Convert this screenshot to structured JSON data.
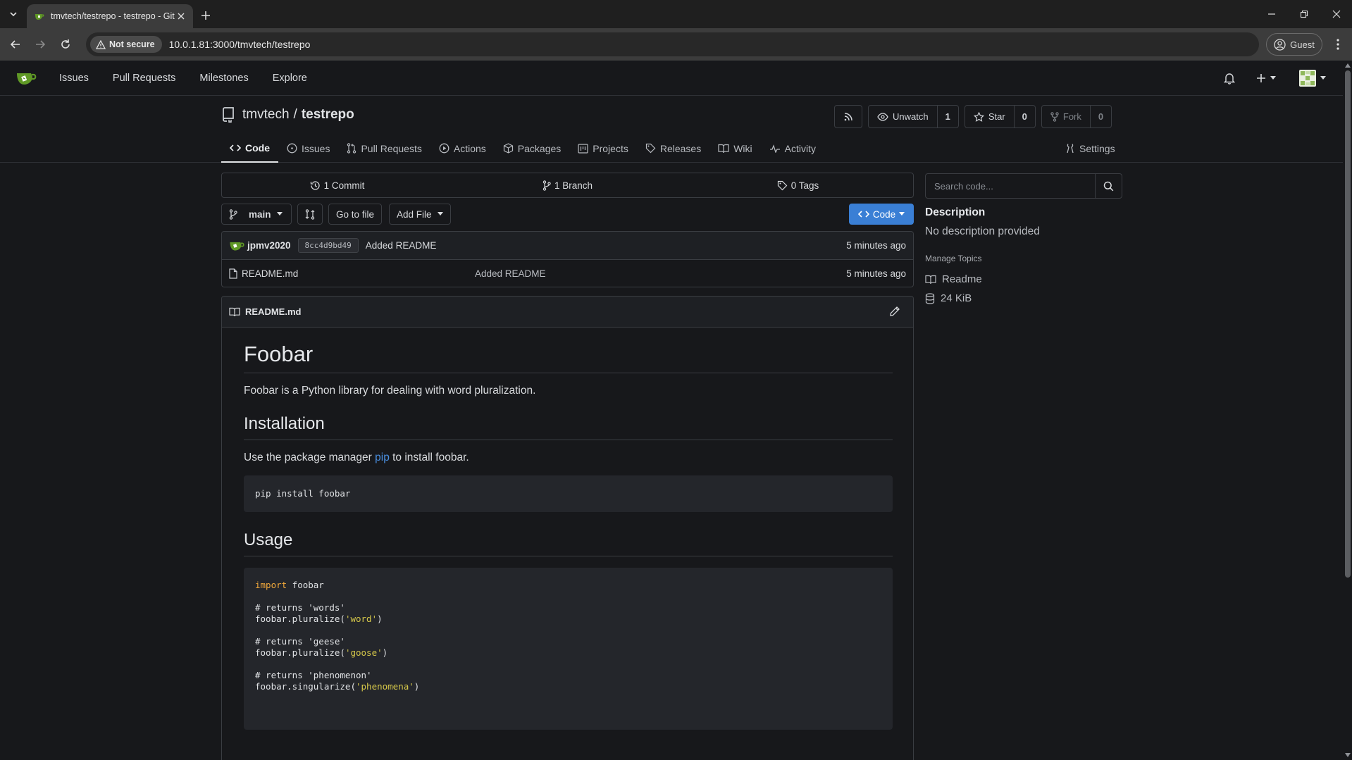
{
  "browser": {
    "tab_title": "tmvtech/testrepo - testrepo - Gitea",
    "security_label": "Not secure",
    "url": "10.0.1.81:3000/tmvtech/testrepo",
    "profile_label": "Guest"
  },
  "header": {
    "nav": [
      "Issues",
      "Pull Requests",
      "Milestones",
      "Explore"
    ]
  },
  "repo": {
    "owner": "tmvtech",
    "separator": "/",
    "name": "testrepo",
    "actions": {
      "unwatch_label": "Unwatch",
      "watch_count": "1",
      "star_label": "Star",
      "star_count": "0",
      "fork_label": "Fork",
      "fork_count": "0"
    },
    "tabs": {
      "code": "Code",
      "issues": "Issues",
      "pulls": "Pull Requests",
      "actions": "Actions",
      "packages": "Packages",
      "projects": "Projects",
      "releases": "Releases",
      "wiki": "Wiki",
      "activity": "Activity",
      "settings": "Settings"
    }
  },
  "stats": {
    "commits": "1 Commit",
    "branches": "1 Branch",
    "tags": "0 Tags"
  },
  "toolbar": {
    "branch": "main",
    "go_to_file": "Go to file",
    "add_file": "Add File",
    "code": "Code"
  },
  "latest_commit": {
    "author": "jpmv2020",
    "sha": "8cc4d9bd49",
    "message": "Added README",
    "time": "5 minutes ago"
  },
  "files": [
    {
      "name": "README.md",
      "commit": "Added README",
      "time": "5 minutes ago"
    }
  ],
  "readme": {
    "filename": "README.md",
    "h1": "Foobar",
    "intro": "Foobar is a Python library for dealing with word pluralization.",
    "installation_heading": "Installation",
    "install_text_before": "Use the package manager ",
    "install_link": "pip",
    "install_text_after": " to install foobar.",
    "install_cmd": "pip install foobar",
    "usage_heading": "Usage",
    "usage": {
      "import_kw": "import",
      "import_mod": " foobar",
      "c1": "# returns 'words'",
      "l1a": "foobar.pluralize(",
      "l1s": "'word'",
      "l1b": ")",
      "c2": "# returns 'geese'",
      "l2a": "foobar.pluralize(",
      "l2s": "'goose'",
      "l2b": ")",
      "c3": "# returns 'phenomenon'",
      "l3a": "foobar.singularize(",
      "l3s": "'phenomena'",
      "l3b": ")"
    }
  },
  "sidebar": {
    "search_placeholder": "Search code...",
    "description_heading": "Description",
    "description": "No description provided",
    "manage_topics": "Manage Topics",
    "readme_label": "Readme",
    "size": "24 KiB"
  },
  "colors": {
    "accent": "#3a7fd5",
    "link": "#4a90e2",
    "gitea_green": "#609926"
  }
}
